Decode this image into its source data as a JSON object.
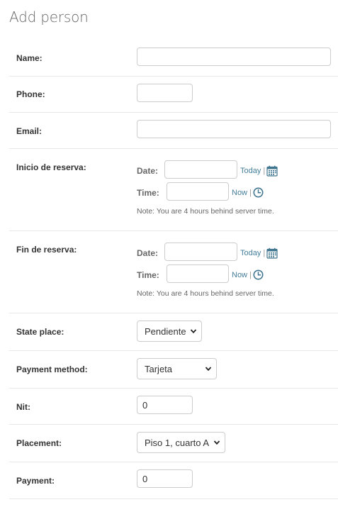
{
  "title": "Add person",
  "fields": {
    "name": {
      "label": "Name:",
      "value": ""
    },
    "phone": {
      "label": "Phone:",
      "value": ""
    },
    "email": {
      "label": "Email:",
      "value": ""
    },
    "inicio": {
      "label": "Inicio de reserva:",
      "date_label": "Date:",
      "time_label": "Time:",
      "today_link": "Today",
      "now_link": "Now",
      "note": "Note: You are 4 hours behind server time.",
      "date_value": "",
      "time_value": ""
    },
    "fin": {
      "label": "Fin de reserva:",
      "date_label": "Date:",
      "time_label": "Time:",
      "today_link": "Today",
      "now_link": "Now",
      "note": "Note: You are 4 hours behind server time.",
      "date_value": "",
      "time_value": ""
    },
    "state_place": {
      "label": "State place:",
      "selected": "Pendiente"
    },
    "payment_method": {
      "label": "Payment method:",
      "selected": "Tarjeta"
    },
    "nit": {
      "label": "Nit:",
      "value": "0"
    },
    "placement": {
      "label": "Placement:",
      "selected": "Piso 1, cuarto A"
    },
    "payment": {
      "label": "Payment:",
      "value": "0"
    }
  },
  "separator": "|",
  "icons": {
    "calendar": "calendar-icon",
    "clock": "clock-icon",
    "chevron": "chevron-down-icon"
  },
  "colors": {
    "link": "#447e9b",
    "icon": "#417690",
    "border": "#cccccc"
  }
}
